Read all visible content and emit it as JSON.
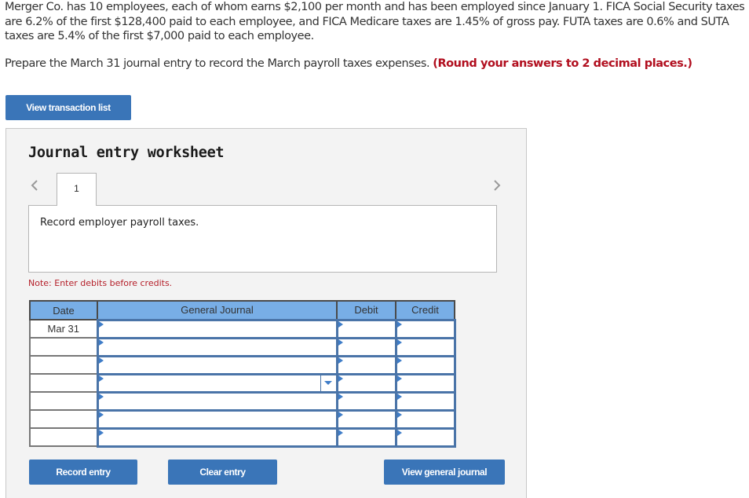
{
  "question": {
    "text": "Merger Co. has 10 employees, each of whom earns $2,100 per month and has been employed since January 1. FICA Social Security taxes are 6.2% of the first $128,400 paid to each employee, and FICA Medicare taxes are 1.45% of gross pay. FUTA taxes are 0.6% and SUTA taxes are 5.4% of the first $7,000 paid to each employee."
  },
  "prompt": {
    "text": "Prepare the March 31 journal entry to record the March payroll taxes expenses.",
    "emphasis": "(Round your answers to 2 decimal places.)"
  },
  "buttons": {
    "view_transaction_list": "View transaction list",
    "record_entry": "Record entry",
    "clear_entry": "Clear entry",
    "view_general_journal": "View general journal"
  },
  "worksheet": {
    "title": "Journal entry worksheet",
    "active_tab": "1",
    "description": "Record employer payroll taxes.",
    "note": "Note: Enter debits before credits."
  },
  "journal": {
    "columns": [
      "Date",
      "General Journal",
      "Debit",
      "Credit"
    ],
    "rows": [
      {
        "date": "Mar 31",
        "account": "",
        "debit": "",
        "credit": ""
      },
      {
        "date": "",
        "account": "",
        "debit": "",
        "credit": ""
      },
      {
        "date": "",
        "account": "",
        "debit": "",
        "credit": ""
      },
      {
        "date": "",
        "account": "",
        "debit": "",
        "credit": "",
        "has_dropdown": true
      },
      {
        "date": "",
        "account": "",
        "debit": "",
        "credit": ""
      },
      {
        "date": "",
        "account": "",
        "debit": "",
        "credit": ""
      },
      {
        "date": "",
        "account": "",
        "debit": "",
        "credit": ""
      }
    ]
  },
  "colors": {
    "primary_button": "#3a75b8",
    "table_header": "#78aee6",
    "emphasis_red": "#b10e1e",
    "input_border": "#4a74a8"
  }
}
